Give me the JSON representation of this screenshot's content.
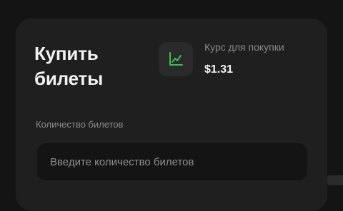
{
  "buy": {
    "title": "Купить\nбилеты",
    "rate_label": "Курс для покупки",
    "rate_value": "$1.31",
    "rate_icon": "chart-up-icon",
    "accent_color": "#3fbf4a"
  },
  "quantity": {
    "label": "Количество билетов",
    "placeholder": "Введите количество билетов",
    "value": ""
  }
}
